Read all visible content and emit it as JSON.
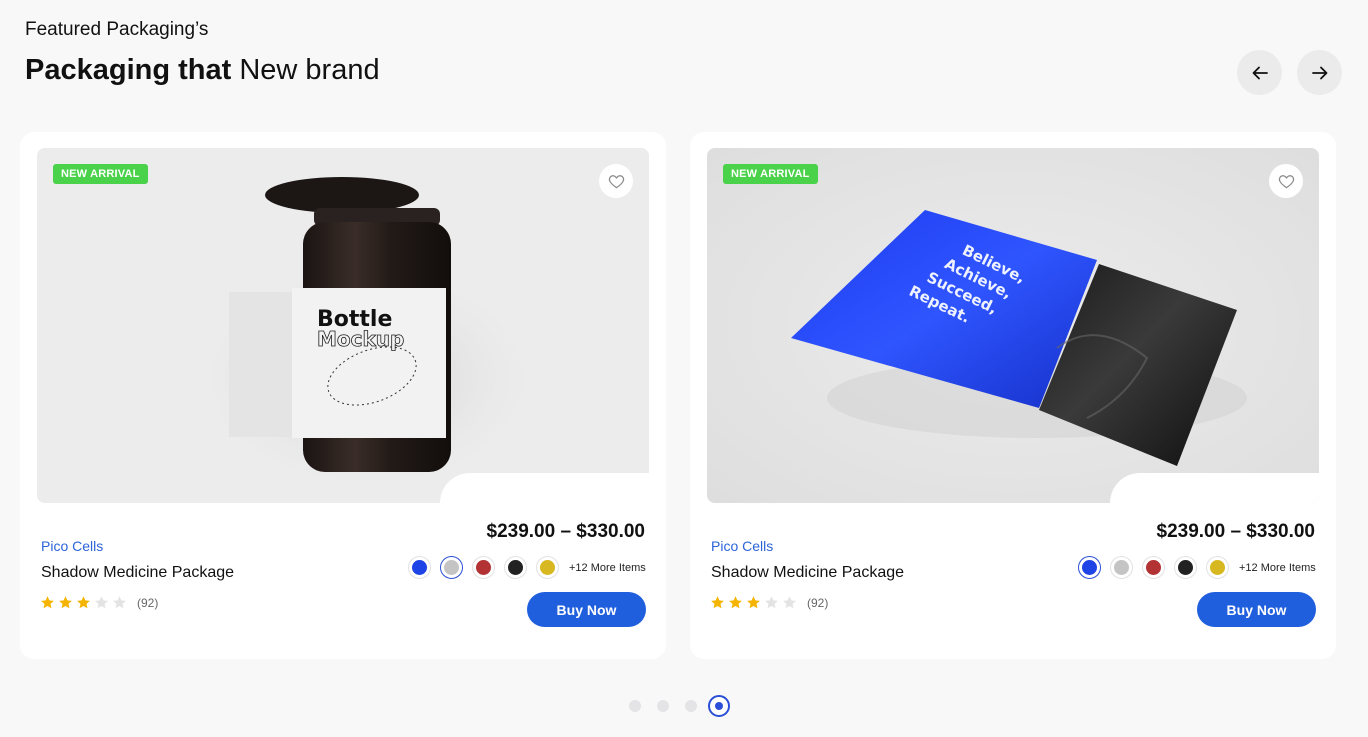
{
  "header": {
    "eyebrow": "Featured Packaging’s",
    "title_bold": "Packaging that",
    "title_light": "New brand"
  },
  "nav": {
    "prev_icon": "arrow-left-icon",
    "next_icon": "arrow-right-icon"
  },
  "cards": [
    {
      "badge": "NEW ARRIVAL",
      "image_text_1": "Bottle",
      "image_text_2": "Mockup",
      "price": "$239.00 – $330.00",
      "brand": "Pico Cells",
      "title": "Shadow Medicine Package",
      "swatches": [
        "#1f44e6",
        "#c4c4c4",
        "#b33335",
        "#222222",
        "#d8b821"
      ],
      "active_swatch_index": 1,
      "more_items": "+12 More Items",
      "rating": 3,
      "rating_max": 5,
      "review_count": "(92)",
      "buy_label": "Buy Now"
    },
    {
      "badge": "NEW ARRIVAL",
      "image_text_1": "Believe,",
      "image_text_2": "Achieve,",
      "image_text_3": "Succeed,",
      "image_text_4": "Repeat.",
      "price": "$239.00 – $330.00",
      "brand": "Pico Cells",
      "title": "Shadow Medicine Package",
      "swatches": [
        "#1f44e6",
        "#c4c4c4",
        "#b33335",
        "#222222",
        "#d8b821"
      ],
      "active_swatch_index": 0,
      "more_items": "+12 More Items",
      "rating": 3,
      "rating_max": 5,
      "review_count": "(92)",
      "buy_label": "Buy Now"
    }
  ],
  "pagination": {
    "count": 4,
    "active_index": 3
  },
  "colors": {
    "accent": "#1f5fdd",
    "badge": "#4bd24b",
    "star": "#f4b400",
    "star_empty": "#e3e3e3",
    "brand_link": "#2b63d8"
  }
}
